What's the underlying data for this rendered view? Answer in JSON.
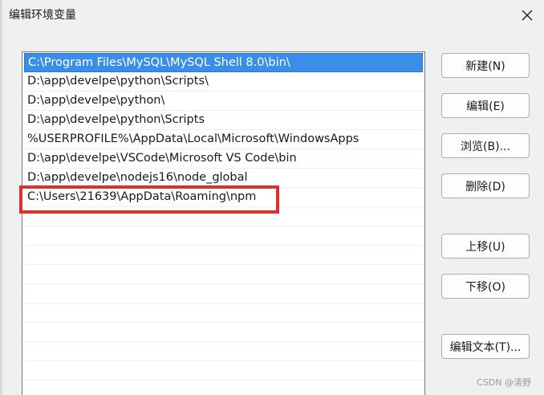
{
  "dialog": {
    "title": "编辑环境变量",
    "close_icon": "close-icon"
  },
  "path_list": [
    "C:\\Program Files\\MySQL\\MySQL Shell 8.0\\bin\\",
    "D:\\app\\develpe\\python\\Scripts\\",
    "D:\\app\\develpe\\python\\",
    "D:\\app\\develpe\\python\\Scripts",
    "%USERPROFILE%\\AppData\\Local\\Microsoft\\WindowsApps",
    "D:\\app\\develpe\\VSCode\\Microsoft VS Code\\bin",
    "D:\\app\\develpe\\nodejs16\\node_global",
    "C:\\Users\\21639\\AppData\\Roaming\\npm"
  ],
  "selected_index": 0,
  "highlighted_index": 7,
  "buttons": {
    "new": "新建(N)",
    "edit": "编辑(E)",
    "browse": "浏览(B)...",
    "delete": "删除(D)",
    "move_up": "上移(U)",
    "move_down": "下移(O)",
    "edit_text": "编辑文本(T)..."
  },
  "watermark": "CSDN @清野",
  "colors": {
    "selection": "#3b8ee8",
    "highlight_border": "#d7332d"
  }
}
